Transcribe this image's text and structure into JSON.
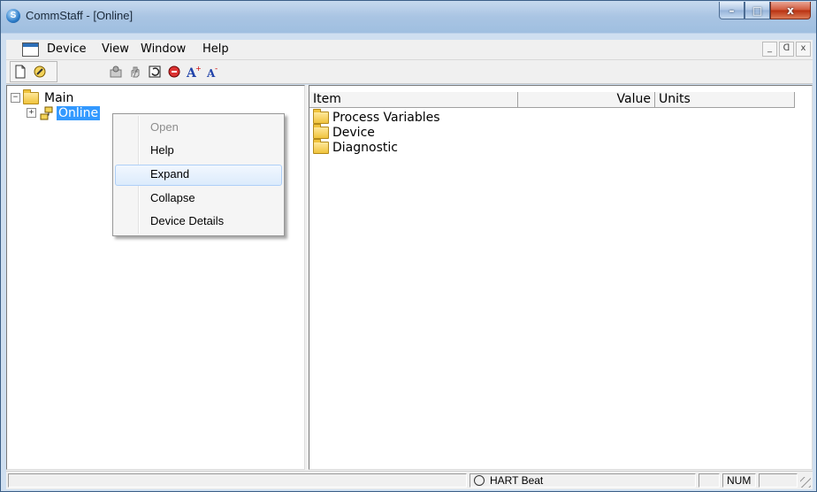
{
  "window": {
    "title": "CommStaff - [Online]",
    "app_icon_glyph": "S",
    "caption_buttons": {
      "minimize": "–",
      "maximize": "□",
      "close": "x"
    }
  },
  "menubar": {
    "items": [
      "Device",
      "View",
      "Window",
      "Help"
    ],
    "mdi_buttons": [
      "_",
      "ᗡ",
      "x"
    ]
  },
  "toolbar": {
    "group1": [
      "new-document-icon",
      "wizard-icon"
    ],
    "group2": [
      "device-config-icon",
      "hand-icon",
      "refresh-icon",
      "stop-icon",
      "font-increase-icon",
      "font-decrease-icon"
    ]
  },
  "tree": {
    "root_label": "Main",
    "root_expander": "−",
    "child_label": "Online",
    "child_expander": "+"
  },
  "list": {
    "columns": [
      "Item",
      "Value",
      "Units"
    ],
    "rows": [
      "Process Variables",
      "Device",
      "Diagnostic"
    ]
  },
  "context_menu": {
    "items": [
      {
        "label": "Open",
        "state": "disabled"
      },
      {
        "label": "Help",
        "state": "normal"
      },
      {
        "label": "Expand",
        "state": "hover"
      },
      {
        "label": "Collapse",
        "state": "normal"
      },
      {
        "label": "Device Details",
        "state": "normal"
      }
    ]
  },
  "statusbar": {
    "heartbeat": "HART Beat",
    "num_lock": "NUM"
  }
}
